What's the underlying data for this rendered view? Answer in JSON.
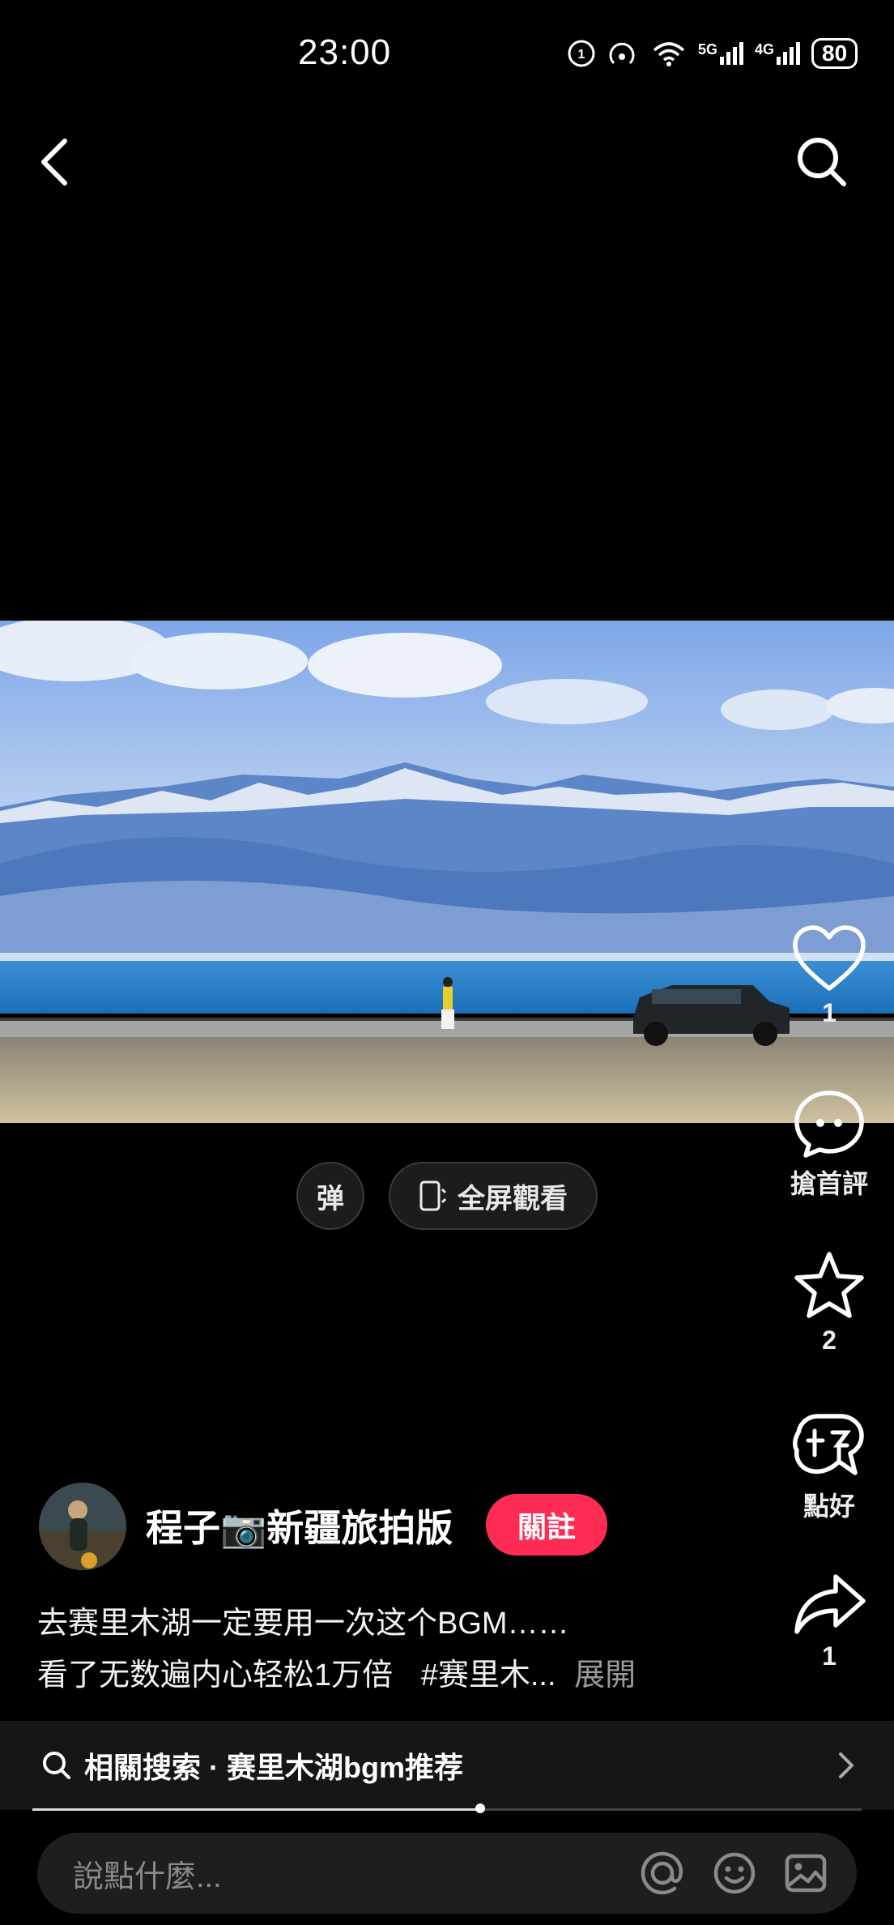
{
  "status_bar": {
    "time": "23:00",
    "battery": "80",
    "network_1": "5G",
    "network_2": "4G"
  },
  "video": {
    "danmu_label": "弹",
    "fullscreen_label": "全屏觀看"
  },
  "actions": {
    "like_count": "1",
    "comment_label": "搶首評",
    "favorite_count": "2",
    "good_label": "點好",
    "share_count": "1"
  },
  "author": {
    "name": "程子📷新疆旅拍版",
    "follow_label": "關註"
  },
  "caption": {
    "line1": "去赛里木湖一定要用一次这个BGM……",
    "line2": "看了无数遍内心轻松1万倍",
    "hashtag": "#赛里木...",
    "expand": "展開"
  },
  "related_search": {
    "text": "相關搜索 · 赛里木湖bgm推荐"
  },
  "playback": {
    "progress": 0.54
  },
  "comment_input": {
    "placeholder": "說點什麼..."
  },
  "icons": [
    "back-icon",
    "search-icon",
    "heart-icon",
    "comment-icon",
    "star-icon",
    "good-icon",
    "share-icon",
    "at-icon",
    "emoji-icon",
    "image-icon",
    "chevron-right-icon"
  ]
}
